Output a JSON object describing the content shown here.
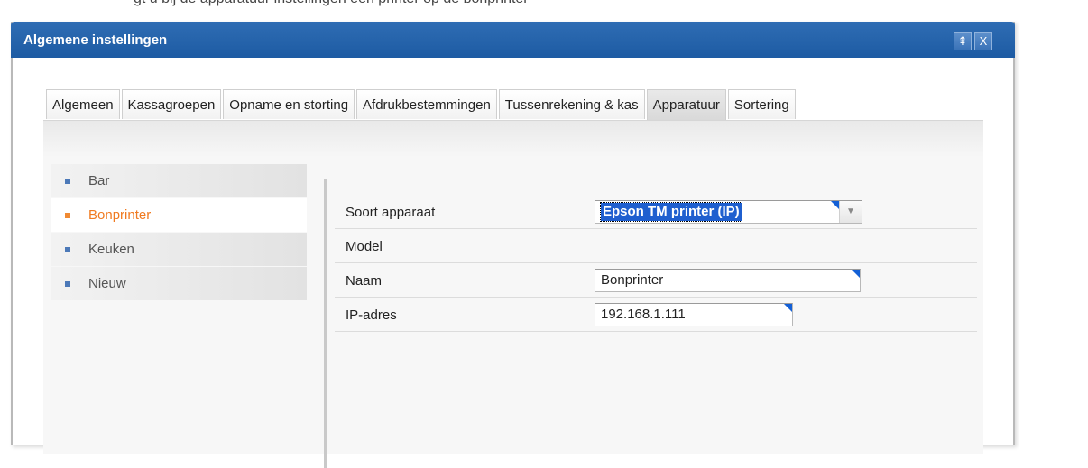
{
  "page": {
    "caption_fragment": "gt u bij de apparatuur instellingen een printer op de bonprinter"
  },
  "window": {
    "title": "Algemene instellingen",
    "pin_glyph": "⇞",
    "close_glyph": "X"
  },
  "tabs": [
    {
      "label": "Algemeen",
      "active": false
    },
    {
      "label": "Kassagroepen",
      "active": false
    },
    {
      "label": "Opname en storting",
      "active": false
    },
    {
      "label": "Afdrukbestemmingen",
      "active": false
    },
    {
      "label": "Tussenrekening & kas",
      "active": false
    },
    {
      "label": "Apparatuur",
      "active": true
    },
    {
      "label": "Sortering",
      "active": false
    }
  ],
  "devices": {
    "items": [
      {
        "label": "Bar",
        "active": false
      },
      {
        "label": "Bonprinter",
        "active": true
      },
      {
        "label": "Keuken",
        "active": false
      },
      {
        "label": "Nieuw",
        "active": false
      }
    ]
  },
  "form": {
    "device_type_label": "Soort apparaat",
    "device_type_value": "Epson TM printer (IP)",
    "model_label": "Model",
    "name_label": "Naam",
    "name_value": "Bonprinter",
    "ip_label": "IP-adres",
    "ip_value": "192.168.1.111",
    "dropdown_glyph": "▼"
  },
  "colors": {
    "titlebar": "#2164ae",
    "active_item": "#f07a20",
    "bullet": "#4c79b8",
    "field_marker": "#1460d6"
  },
  "icons": {
    "pin": "pin-icon",
    "close": "close-icon",
    "dropdown": "chevron-down-icon",
    "bullet": "square-bullet-icon"
  }
}
